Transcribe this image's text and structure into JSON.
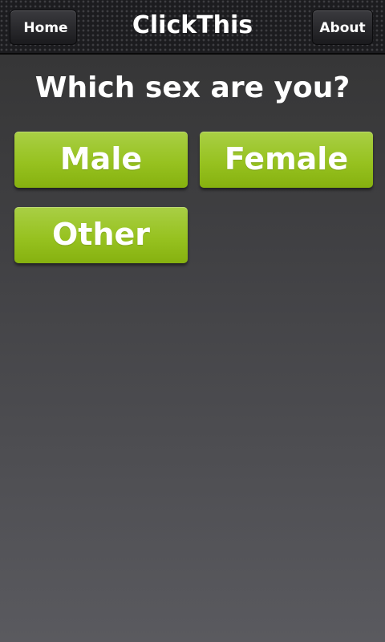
{
  "header": {
    "title": "ClickThis",
    "home_label": "Home",
    "about_label": "About"
  },
  "main": {
    "question": "Which sex are you?",
    "options": [
      {
        "label": "Male"
      },
      {
        "label": "Female"
      },
      {
        "label": "Other"
      }
    ]
  },
  "colors": {
    "button_green": "#97c220",
    "header_dark": "#1c1c1f",
    "background": "#414144"
  }
}
